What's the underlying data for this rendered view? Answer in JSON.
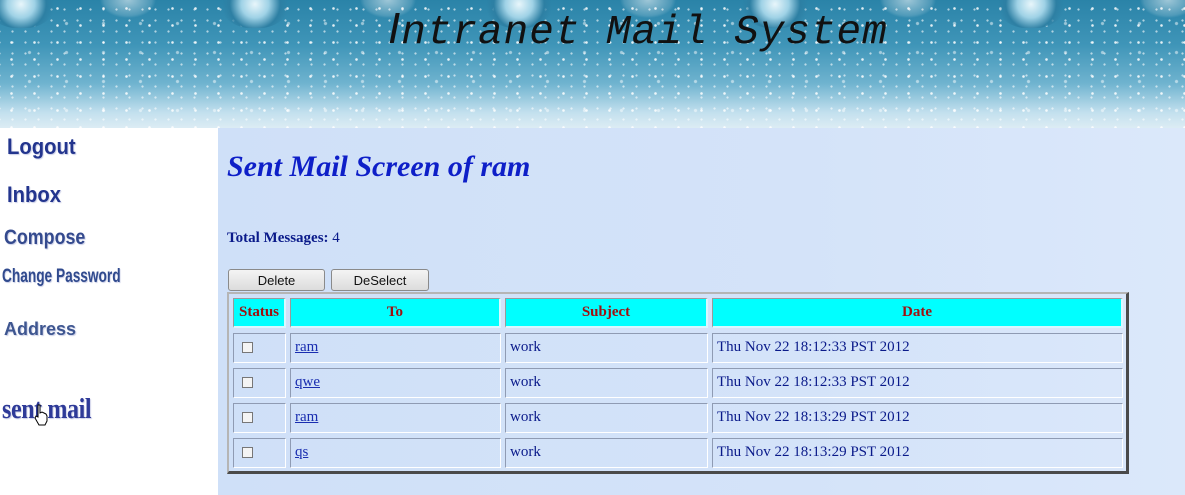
{
  "header": {
    "title_initial": "I",
    "title_rest": "ntranet Mail System"
  },
  "sidebar": {
    "items": [
      {
        "label": "Logout"
      },
      {
        "label": "Inbox"
      },
      {
        "label": "Compose"
      },
      {
        "label": "Change Password"
      },
      {
        "label": "Address"
      },
      {
        "label": "sent mail"
      }
    ]
  },
  "main": {
    "title": "Sent Mail Screen of ram",
    "total_label": "Total Messages:",
    "total_value": "4",
    "buttons": {
      "delete": "Delete",
      "deselect": "DeSelect"
    },
    "table": {
      "headers": [
        "Status",
        "To",
        "Subject",
        "Date"
      ],
      "rows": [
        {
          "to": "ram",
          "subject": "work",
          "date": "Thu Nov 22 18:12:33 PST 2012"
        },
        {
          "to": "qwe",
          "subject": "work",
          "date": "Thu Nov 22 18:12:33 PST 2012"
        },
        {
          "to": "ram",
          "subject": "work",
          "date": "Thu Nov 22 18:13:29 PST 2012"
        },
        {
          "to": "qs",
          "subject": "work",
          "date": "Thu Nov 22 18:13:29 PST 2012"
        }
      ]
    }
  },
  "colors": {
    "header_cell_bg": "#00ffff",
    "header_text": "#a01010",
    "title": "#0e1fc8",
    "main_bg": "#d4e3f9"
  }
}
